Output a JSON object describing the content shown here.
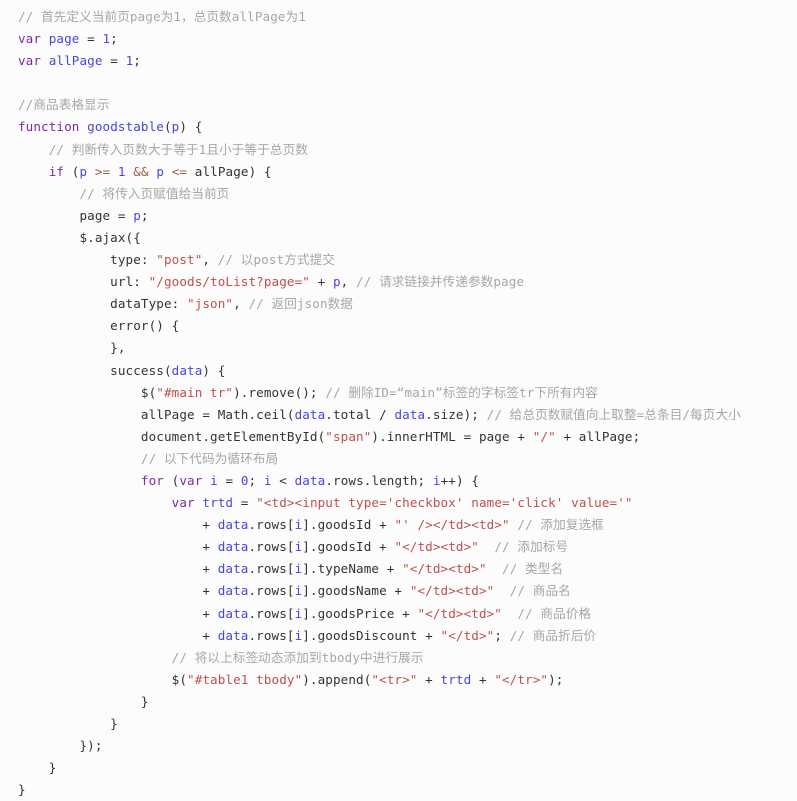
{
  "document": {
    "kind": "code-snippet",
    "language": "javascript",
    "background_color": "#fcfcfc",
    "colors": {
      "comment": "#a6a6a6",
      "keyword": "#7f28a8",
      "identifier": "#4646e6",
      "string": "#c0504d",
      "operator": "#9c5c4a",
      "plain": "#333333"
    }
  },
  "code": {
    "lines": [
      {
        "id": "line-1",
        "tokens": [
          {
            "t": "cm",
            "v": "// 首先定义当前页page为1，总页数allPage为1"
          }
        ]
      },
      {
        "id": "line-2",
        "tokens": [
          {
            "t": "kw",
            "v": "var"
          },
          {
            "t": "pl",
            "v": " "
          },
          {
            "t": "id",
            "v": "page"
          },
          {
            "t": "pl",
            "v": " = "
          },
          {
            "t": "num",
            "v": "1"
          },
          {
            "t": "pn",
            "v": ";"
          }
        ]
      },
      {
        "id": "line-3",
        "tokens": [
          {
            "t": "kw",
            "v": "var"
          },
          {
            "t": "pl",
            "v": " "
          },
          {
            "t": "id",
            "v": "allPage"
          },
          {
            "t": "pl",
            "v": " = "
          },
          {
            "t": "num",
            "v": "1"
          },
          {
            "t": "pn",
            "v": ";"
          }
        ]
      },
      {
        "id": "line-4",
        "tokens": []
      },
      {
        "id": "line-5",
        "tokens": [
          {
            "t": "cm",
            "v": "//商品表格显示"
          }
        ]
      },
      {
        "id": "line-6",
        "tokens": [
          {
            "t": "kw",
            "v": "function"
          },
          {
            "t": "pl",
            "v": " "
          },
          {
            "t": "fn",
            "v": "goodstable"
          },
          {
            "t": "pn",
            "v": "("
          },
          {
            "t": "id",
            "v": "p"
          },
          {
            "t": "pn",
            "v": ") {"
          }
        ]
      },
      {
        "id": "line-7",
        "tokens": [
          {
            "t": "pl",
            "v": "    "
          },
          {
            "t": "cm",
            "v": "// 判断传入页数大于等于1且小于等于总页数"
          }
        ]
      },
      {
        "id": "line-8",
        "tokens": [
          {
            "t": "pl",
            "v": "    "
          },
          {
            "t": "kw",
            "v": "if"
          },
          {
            "t": "pl",
            "v": " ("
          },
          {
            "t": "id",
            "v": "p"
          },
          {
            "t": "pl",
            "v": " "
          },
          {
            "t": "op",
            "v": ">="
          },
          {
            "t": "pl",
            "v": " "
          },
          {
            "t": "num",
            "v": "1"
          },
          {
            "t": "pl",
            "v": " "
          },
          {
            "t": "op",
            "v": "&&"
          },
          {
            "t": "pl",
            "v": " "
          },
          {
            "t": "id",
            "v": "p"
          },
          {
            "t": "pl",
            "v": " "
          },
          {
            "t": "op",
            "v": "<="
          },
          {
            "t": "pl",
            "v": " allPage) {"
          }
        ]
      },
      {
        "id": "line-9",
        "tokens": [
          {
            "t": "pl",
            "v": "        "
          },
          {
            "t": "cm",
            "v": "// 将传入页赋值给当前页"
          }
        ]
      },
      {
        "id": "line-10",
        "tokens": [
          {
            "t": "pl",
            "v": "        page = "
          },
          {
            "t": "id",
            "v": "p"
          },
          {
            "t": "pn",
            "v": ";"
          }
        ]
      },
      {
        "id": "line-11",
        "tokens": [
          {
            "t": "pl",
            "v": "        $.ajax({"
          }
        ]
      },
      {
        "id": "line-12",
        "tokens": [
          {
            "t": "pl",
            "v": "            type: "
          },
          {
            "t": "str",
            "v": "\"post\""
          },
          {
            "t": "pl",
            "v": ", "
          },
          {
            "t": "cm",
            "v": "// 以post方式提交"
          }
        ]
      },
      {
        "id": "line-13",
        "tokens": [
          {
            "t": "pl",
            "v": "            url: "
          },
          {
            "t": "str",
            "v": "\"/goods/toList?page=\""
          },
          {
            "t": "pl",
            "v": " + "
          },
          {
            "t": "id",
            "v": "p"
          },
          {
            "t": "pl",
            "v": ", "
          },
          {
            "t": "cm",
            "v": "// 请求链接并传递参数page"
          }
        ]
      },
      {
        "id": "line-14",
        "tokens": [
          {
            "t": "pl",
            "v": "            dataType: "
          },
          {
            "t": "str",
            "v": "\"json\""
          },
          {
            "t": "pl",
            "v": ", "
          },
          {
            "t": "cm",
            "v": "// 返回json数据"
          }
        ]
      },
      {
        "id": "line-15",
        "tokens": [
          {
            "t": "pl",
            "v": "            error() {"
          }
        ]
      },
      {
        "id": "line-16",
        "tokens": [
          {
            "t": "pl",
            "v": "            },"
          }
        ]
      },
      {
        "id": "line-17",
        "tokens": [
          {
            "t": "pl",
            "v": "            success("
          },
          {
            "t": "id",
            "v": "data"
          },
          {
            "t": "pl",
            "v": ") {"
          }
        ]
      },
      {
        "id": "line-18",
        "tokens": [
          {
            "t": "pl",
            "v": "                $("
          },
          {
            "t": "str",
            "v": "\"#main tr\""
          },
          {
            "t": "pl",
            "v": ").remove(); "
          },
          {
            "t": "cm",
            "v": "// 删除ID=“main”标签的字标签tr下所有内容"
          }
        ]
      },
      {
        "id": "line-19",
        "tokens": [
          {
            "t": "pl",
            "v": "                allPage = Math.ceil("
          },
          {
            "t": "id",
            "v": "data"
          },
          {
            "t": "pl",
            "v": ".total / "
          },
          {
            "t": "id",
            "v": "data"
          },
          {
            "t": "pl",
            "v": ".size); "
          },
          {
            "t": "cm",
            "v": "// 给总页数赋值向上取整=总条目/每页大小"
          }
        ]
      },
      {
        "id": "line-20",
        "tokens": [
          {
            "t": "pl",
            "v": "                document.getElementById("
          },
          {
            "t": "str",
            "v": "\"span\""
          },
          {
            "t": "pl",
            "v": ").innerHTML = page + "
          },
          {
            "t": "str",
            "v": "\"/\""
          },
          {
            "t": "pl",
            "v": " + allPage;"
          }
        ]
      },
      {
        "id": "line-21",
        "tokens": [
          {
            "t": "pl",
            "v": "                "
          },
          {
            "t": "cm",
            "v": "// 以下代码为循环布局"
          }
        ]
      },
      {
        "id": "line-22",
        "tokens": [
          {
            "t": "pl",
            "v": "                "
          },
          {
            "t": "kw",
            "v": "for"
          },
          {
            "t": "pl",
            "v": " ("
          },
          {
            "t": "kw",
            "v": "var"
          },
          {
            "t": "pl",
            "v": " "
          },
          {
            "t": "id",
            "v": "i"
          },
          {
            "t": "pl",
            "v": " = "
          },
          {
            "t": "num",
            "v": "0"
          },
          {
            "t": "pl",
            "v": "; "
          },
          {
            "t": "id",
            "v": "i"
          },
          {
            "t": "pl",
            "v": " < "
          },
          {
            "t": "id",
            "v": "data"
          },
          {
            "t": "pl",
            "v": ".rows.length; "
          },
          {
            "t": "id",
            "v": "i"
          },
          {
            "t": "pl",
            "v": "++) {"
          }
        ]
      },
      {
        "id": "line-23",
        "tokens": [
          {
            "t": "pl",
            "v": "                    "
          },
          {
            "t": "kw",
            "v": "var"
          },
          {
            "t": "pl",
            "v": " "
          },
          {
            "t": "id",
            "v": "trtd"
          },
          {
            "t": "pl",
            "v": " = "
          },
          {
            "t": "str",
            "v": "\"<td><input type='checkbox' name='click' value='\""
          }
        ]
      },
      {
        "id": "line-24",
        "tokens": [
          {
            "t": "pl",
            "v": "                        + "
          },
          {
            "t": "id",
            "v": "data"
          },
          {
            "t": "pl",
            "v": ".rows["
          },
          {
            "t": "id",
            "v": "i"
          },
          {
            "t": "pl",
            "v": "].goodsId + "
          },
          {
            "t": "str",
            "v": "\"' /></td><td>\""
          },
          {
            "t": "pl",
            "v": " "
          },
          {
            "t": "cm",
            "v": "// 添加复选框"
          }
        ]
      },
      {
        "id": "line-25",
        "tokens": [
          {
            "t": "pl",
            "v": "                        + "
          },
          {
            "t": "id",
            "v": "data"
          },
          {
            "t": "pl",
            "v": ".rows["
          },
          {
            "t": "id",
            "v": "i"
          },
          {
            "t": "pl",
            "v": "].goodsId + "
          },
          {
            "t": "str",
            "v": "\"</td><td>\""
          },
          {
            "t": "pl",
            "v": "  "
          },
          {
            "t": "cm",
            "v": "// 添加标号"
          }
        ]
      },
      {
        "id": "line-26",
        "tokens": [
          {
            "t": "pl",
            "v": "                        + "
          },
          {
            "t": "id",
            "v": "data"
          },
          {
            "t": "pl",
            "v": ".rows["
          },
          {
            "t": "id",
            "v": "i"
          },
          {
            "t": "pl",
            "v": "].typeName + "
          },
          {
            "t": "str",
            "v": "\"</td><td>\""
          },
          {
            "t": "pl",
            "v": "  "
          },
          {
            "t": "cm",
            "v": "// 类型名"
          }
        ]
      },
      {
        "id": "line-27",
        "tokens": [
          {
            "t": "pl",
            "v": "                        + "
          },
          {
            "t": "id",
            "v": "data"
          },
          {
            "t": "pl",
            "v": ".rows["
          },
          {
            "t": "id",
            "v": "i"
          },
          {
            "t": "pl",
            "v": "].goodsName + "
          },
          {
            "t": "str",
            "v": "\"</td><td>\""
          },
          {
            "t": "pl",
            "v": "  "
          },
          {
            "t": "cm",
            "v": "// 商品名"
          }
        ]
      },
      {
        "id": "line-28",
        "tokens": [
          {
            "t": "pl",
            "v": "                        + "
          },
          {
            "t": "id",
            "v": "data"
          },
          {
            "t": "pl",
            "v": ".rows["
          },
          {
            "t": "id",
            "v": "i"
          },
          {
            "t": "pl",
            "v": "].goodsPrice + "
          },
          {
            "t": "str",
            "v": "\"</td><td>\""
          },
          {
            "t": "pl",
            "v": "  "
          },
          {
            "t": "cm",
            "v": "// 商品价格"
          }
        ]
      },
      {
        "id": "line-29",
        "tokens": [
          {
            "t": "pl",
            "v": "                        + "
          },
          {
            "t": "id",
            "v": "data"
          },
          {
            "t": "pl",
            "v": ".rows["
          },
          {
            "t": "id",
            "v": "i"
          },
          {
            "t": "pl",
            "v": "].goodsDiscount + "
          },
          {
            "t": "str",
            "v": "\"</td>\""
          },
          {
            "t": "pl",
            "v": "; "
          },
          {
            "t": "cm",
            "v": "// 商品折后价"
          }
        ]
      },
      {
        "id": "line-30",
        "tokens": [
          {
            "t": "pl",
            "v": "                    "
          },
          {
            "t": "cm",
            "v": "// 将以上标签动态添加到tbody中进行展示"
          }
        ]
      },
      {
        "id": "line-31",
        "tokens": [
          {
            "t": "pl",
            "v": "                    $("
          },
          {
            "t": "str",
            "v": "\"#table1 tbody\""
          },
          {
            "t": "pl",
            "v": ").append("
          },
          {
            "t": "str",
            "v": "\"<tr>\""
          },
          {
            "t": "pl",
            "v": " + "
          },
          {
            "t": "id",
            "v": "trtd"
          },
          {
            "t": "pl",
            "v": " + "
          },
          {
            "t": "str",
            "v": "\"</tr>\""
          },
          {
            "t": "pl",
            "v": ");"
          }
        ]
      },
      {
        "id": "line-32",
        "tokens": [
          {
            "t": "pl",
            "v": "                }"
          }
        ]
      },
      {
        "id": "line-33",
        "tokens": [
          {
            "t": "pl",
            "v": "            }"
          }
        ]
      },
      {
        "id": "line-34",
        "tokens": [
          {
            "t": "pl",
            "v": "        });"
          }
        ]
      },
      {
        "id": "line-35",
        "tokens": [
          {
            "t": "pl",
            "v": "    }"
          }
        ]
      },
      {
        "id": "line-36",
        "tokens": [
          {
            "t": "pl",
            "v": "}"
          }
        ]
      }
    ]
  }
}
